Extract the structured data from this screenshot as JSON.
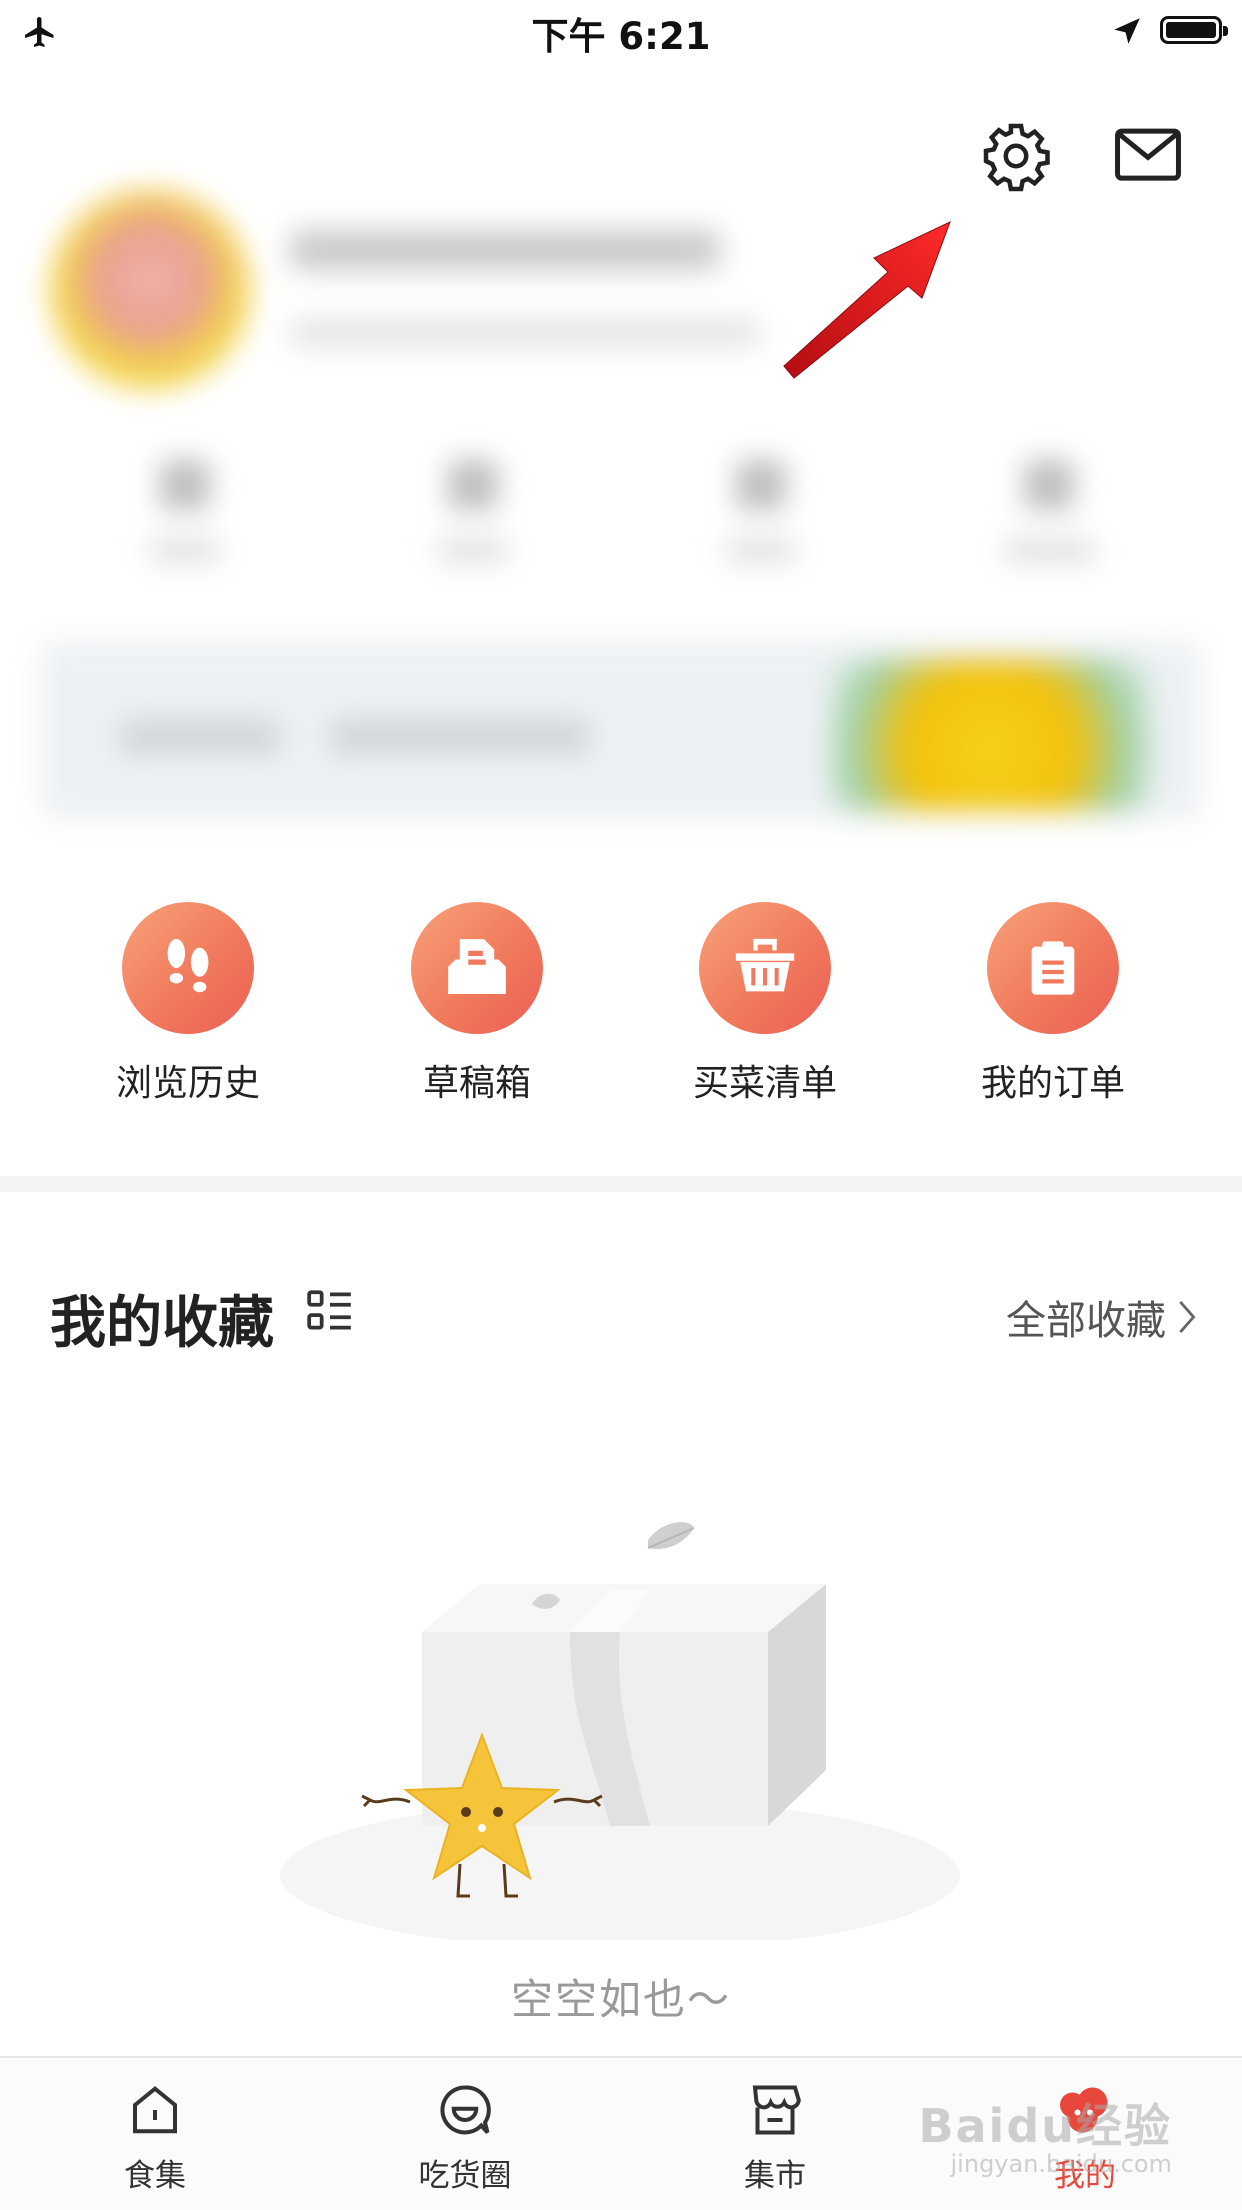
{
  "status_bar": {
    "time": "下午 6:21",
    "icons": [
      "airplane-mode-icon",
      "location-arrow-icon",
      "battery-icon"
    ]
  },
  "header": {
    "icons": [
      "settings-gear-icon",
      "mail-icon"
    ]
  },
  "shortcuts": [
    {
      "label": "浏览历史",
      "icon": "footprints-icon"
    },
    {
      "label": "草稿箱",
      "icon": "draft-tray-icon"
    },
    {
      "label": "买菜清单",
      "icon": "basket-icon"
    },
    {
      "label": "我的订单",
      "icon": "clipboard-icon"
    }
  ],
  "favorites": {
    "title": "我的收藏",
    "all_link": "全部收藏",
    "empty_text": "空空如也～"
  },
  "tabbar": {
    "items": [
      {
        "label": "食集",
        "icon": "home-icon",
        "active": false
      },
      {
        "label": "吃货圈",
        "icon": "smile-chat-icon",
        "active": false
      },
      {
        "label": "集市",
        "icon": "store-icon",
        "active": false
      },
      {
        "label": "我的",
        "icon": "profile-icon",
        "active": true
      }
    ]
  },
  "watermark": {
    "text": "Baidu经验",
    "sub": "jingyan.baidu.com"
  },
  "colors": {
    "accent": "#e8483b",
    "gradient_start": "#f9a27a",
    "gradient_end": "#ec5f55",
    "annotation_arrow": "#e3141c"
  }
}
